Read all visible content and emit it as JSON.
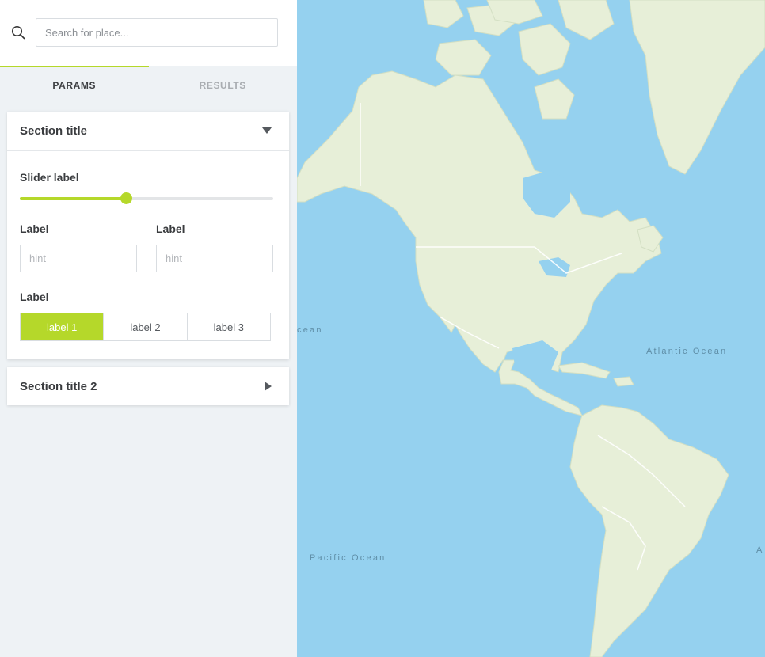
{
  "search": {
    "placeholder": "Search for place..."
  },
  "tabs": [
    {
      "label": "PARAMS",
      "active": true
    },
    {
      "label": "RESULTS",
      "active": false
    }
  ],
  "section1": {
    "title": "Section title",
    "expanded": true,
    "slider": {
      "label": "Slider label",
      "value_fraction": 0.42
    },
    "inputs": [
      {
        "label": "Label",
        "placeholder": "hint",
        "value": ""
      },
      {
        "label": "Label",
        "placeholder": "hint",
        "value": ""
      }
    ],
    "segment": {
      "label": "Label",
      "options": [
        "label 1",
        "label 2",
        "label 3"
      ],
      "selected": "label 1"
    }
  },
  "section2": {
    "title": "Section title 2",
    "expanded": false
  },
  "map": {
    "ocean_labels": [
      "Atlantic Ocean",
      "Pacific Ocean",
      "cean",
      "A"
    ]
  },
  "colors": {
    "accent": "#b5d82a",
    "water": "#95d1ef",
    "land": "#e7efd8"
  }
}
